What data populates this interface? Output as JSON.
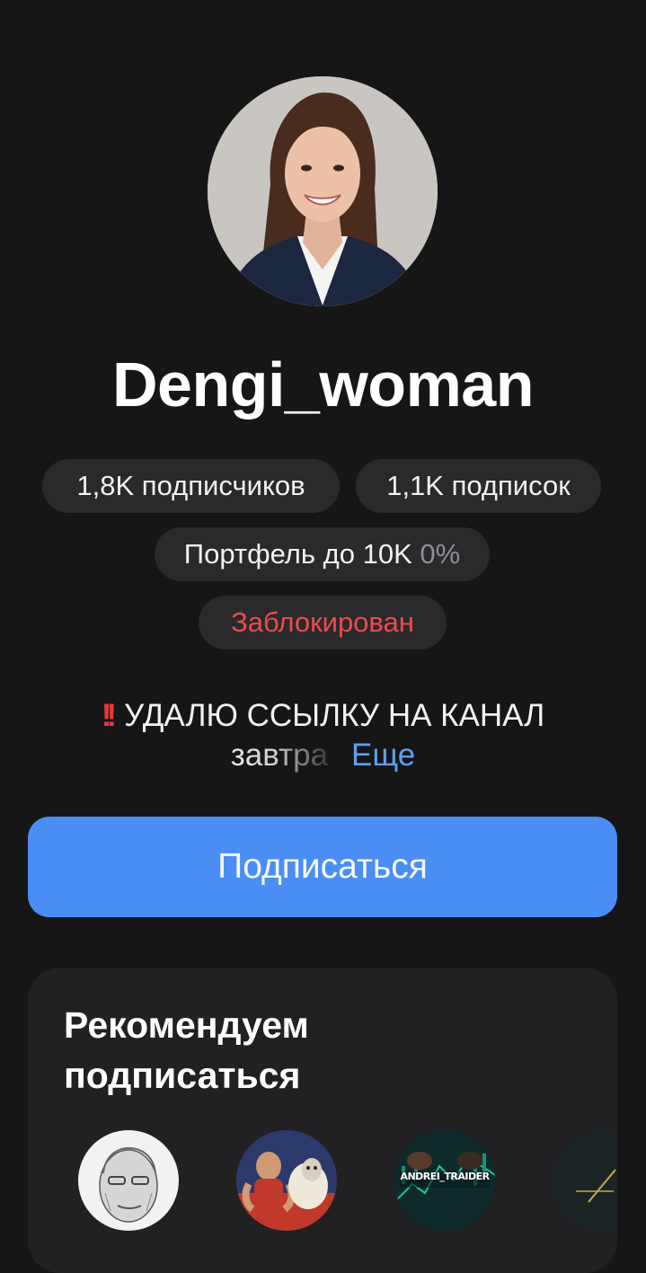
{
  "profile": {
    "username": "Dengi_woman",
    "subscribers": "1,8K подписчиков",
    "subscriptions": "1,1K подписок",
    "portfolio_label": "Портфель до 10K",
    "portfolio_pct": "0%",
    "status": "Заблокирован"
  },
  "bio": {
    "emoji": "!!",
    "line1": "УДАЛЮ ССЫЛКУ НА КАНАЛ",
    "line2": "завтра",
    "more": "Еще"
  },
  "actions": {
    "subscribe": "Подписаться"
  },
  "recommend": {
    "title_line1": "Рекомендуем",
    "title_line2": "подписаться",
    "items": [
      {
        "label": ""
      },
      {
        "label": ""
      },
      {
        "label": "ANDREI_TRAIDER"
      },
      {
        "label": ""
      }
    ]
  },
  "icons": {
    "back": "back-arrow-icon"
  },
  "colors": {
    "background": "#161617",
    "chip": "#2a2a2c",
    "accent": "#4a8ef5",
    "link": "#5ea0ee",
    "blocked": "#ec4b4b"
  }
}
